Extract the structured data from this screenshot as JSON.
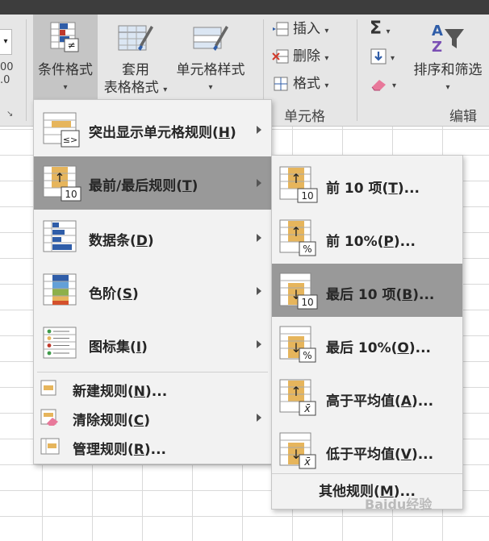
{
  "ribbon": {
    "left": {
      "combo_arrow": "▾",
      "num1": "00",
      "num2": ".0",
      "launcher": "↘"
    },
    "conditional_formatting": "条件格式",
    "format_as_table_line1": "套用",
    "format_as_table_line2": "表格格式",
    "cell_styles": "单元格样式",
    "insert": "插入",
    "delete": "删除",
    "format": "格式",
    "cells_group": "单元格",
    "sort_filter": "排序和筛选",
    "editing_group": "编辑",
    "sum_symbol": "Σ",
    "dropdown": "▾"
  },
  "main_menu": {
    "items": [
      {
        "label": "突出显示单元格规则(",
        "key": "H",
        "tail": ")"
      },
      {
        "label": "最前/最后规则(",
        "key": "T",
        "tail": ")"
      },
      {
        "label": "数据条(",
        "key": "D",
        "tail": ")"
      },
      {
        "label": "色阶(",
        "key": "S",
        "tail": ")"
      },
      {
        "label": "图标集(",
        "key": "I",
        "tail": ")"
      },
      {
        "label": "新建规则(",
        "key": "N",
        "tail": ")..."
      },
      {
        "label": "清除规则(",
        "key": "C",
        "tail": ")"
      },
      {
        "label": "管理规则(",
        "key": "R",
        "tail": ")..."
      }
    ]
  },
  "sub_menu": {
    "items": [
      {
        "label": "前 10 项(",
        "key": "T",
        "tail": ")..."
      },
      {
        "label": "前 10%(",
        "key": "P",
        "tail": ")..."
      },
      {
        "label": "最后 10 项(",
        "key": "B",
        "tail": ")..."
      },
      {
        "label": "最后 10%(",
        "key": "O",
        "tail": ")..."
      },
      {
        "label": "高于平均值(",
        "key": "A",
        "tail": ")..."
      },
      {
        "label": "低于平均值(",
        "key": "V",
        "tail": ")..."
      }
    ],
    "more_rules": {
      "label": "其他规则(",
      "key": "M",
      "tail": ")..."
    }
  },
  "icons": {
    "badge_ten": "10",
    "badge_pct": "%",
    "badge_ne": "≠",
    "badge_le_ge": "≤>",
    "badge_avg": "x̄",
    "arrow_up": "↑",
    "arrow_down": "↓"
  },
  "watermark": "Baidu经验",
  "colors": {
    "ribbon_bg": "#e6e6e6",
    "menu_bg": "#f2f2f2",
    "hover_bg": "#999999",
    "icon_gold": "#e6b55c",
    "icon_blue": "#2f5da8",
    "titlebar": "#3d3d3d"
  }
}
